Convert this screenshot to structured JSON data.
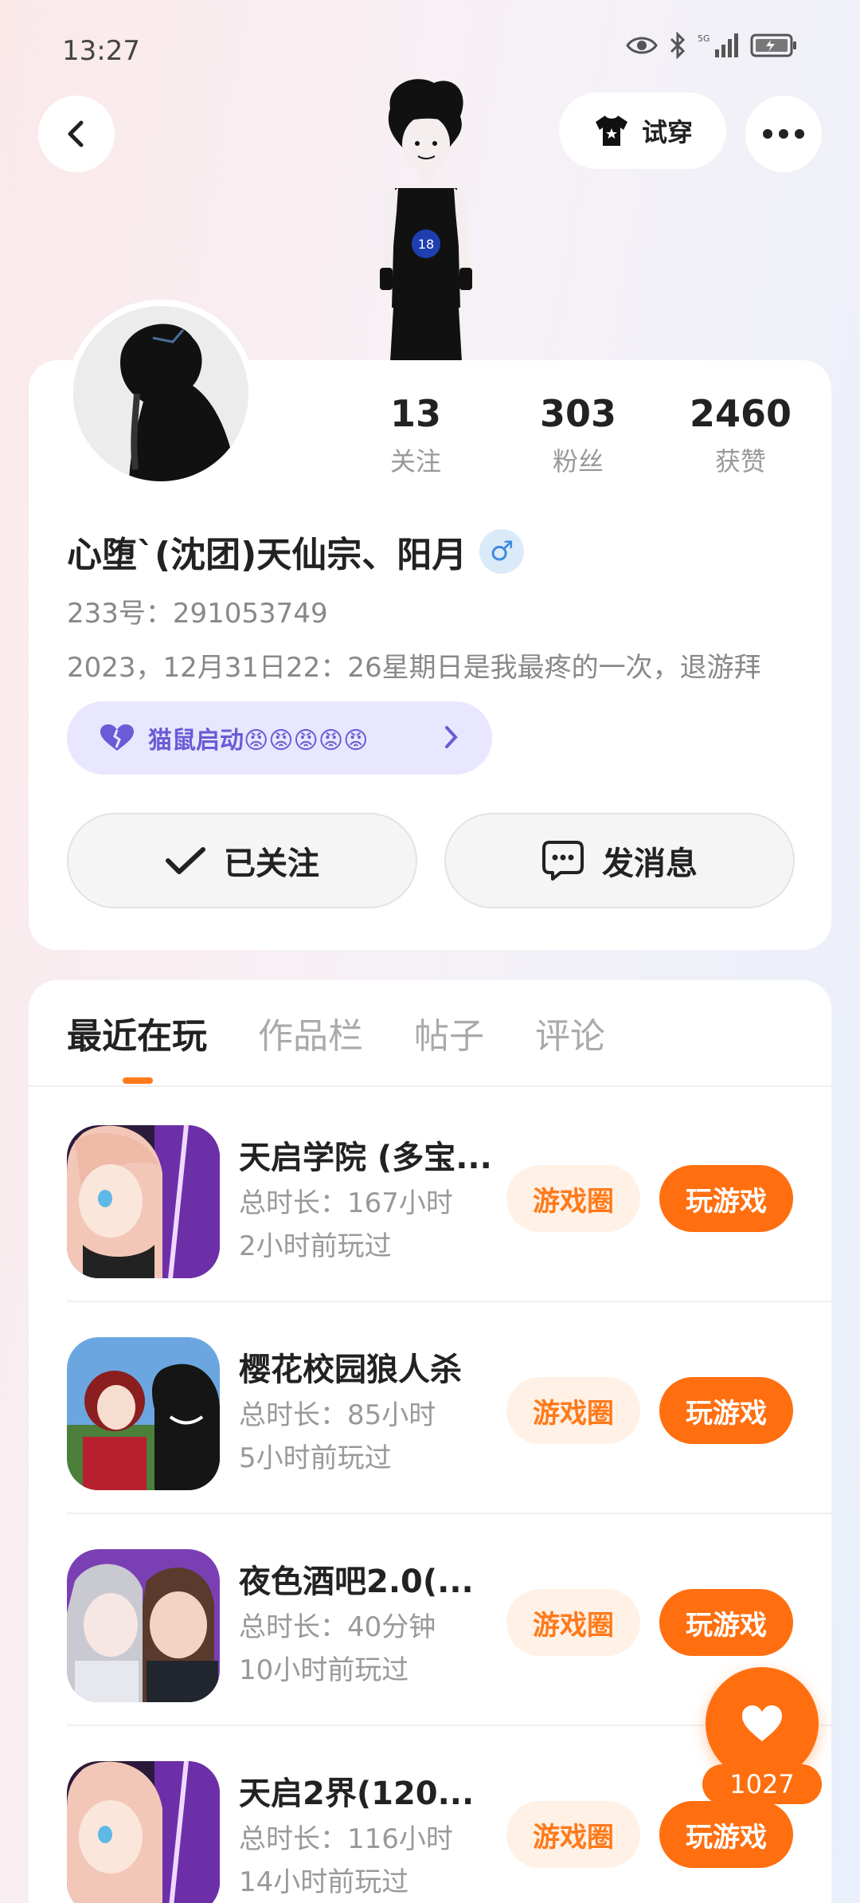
{
  "status_bar": {
    "time": "13:27"
  },
  "header": {
    "tryon_label": "试穿"
  },
  "stats": [
    {
      "num": "13",
      "label": "关注"
    },
    {
      "num": "303",
      "label": "粉丝"
    },
    {
      "num": "2460",
      "label": "获赞"
    }
  ],
  "profile": {
    "name": "心堕`(沈团)天仙宗、阳月",
    "gender_symbol": "♂",
    "uid": "233号：291053749",
    "bio": "2023，12月31日22：26星期日是我最疼的一次，退游拜",
    "tag": "猫鼠启动😡😡😡😡😡"
  },
  "actions": {
    "followed": "已关注",
    "message": "发消息"
  },
  "tabs": [
    "最近在玩",
    "作品栏",
    "帖子",
    "评论"
  ],
  "games": [
    {
      "name": "天启学院 (多宝...",
      "duration": "总时长：167小时",
      "last_played": "2小时前玩过",
      "circle_label": "游戏圈",
      "play_label": "玩游戏"
    },
    {
      "name": "樱花校园狼人杀",
      "duration": "总时长：85小时",
      "last_played": "5小时前玩过",
      "circle_label": "游戏圈",
      "play_label": "玩游戏"
    },
    {
      "name": "夜色酒吧2.0(...",
      "duration": "总时长：40分钟",
      "last_played": "10小时前玩过",
      "circle_label": "游戏圈",
      "play_label": "玩游戏"
    },
    {
      "name": "天启2界(120...",
      "duration": "总时长：116小时",
      "last_played": "14小时前玩过",
      "circle_label": "游戏圈",
      "play_label": "玩游戏"
    }
  ],
  "like_count": "1027",
  "colors": {
    "accent": "#ff6f10",
    "tag_bg": "#e9e7ff",
    "tag_text": "#6a5bd6"
  }
}
